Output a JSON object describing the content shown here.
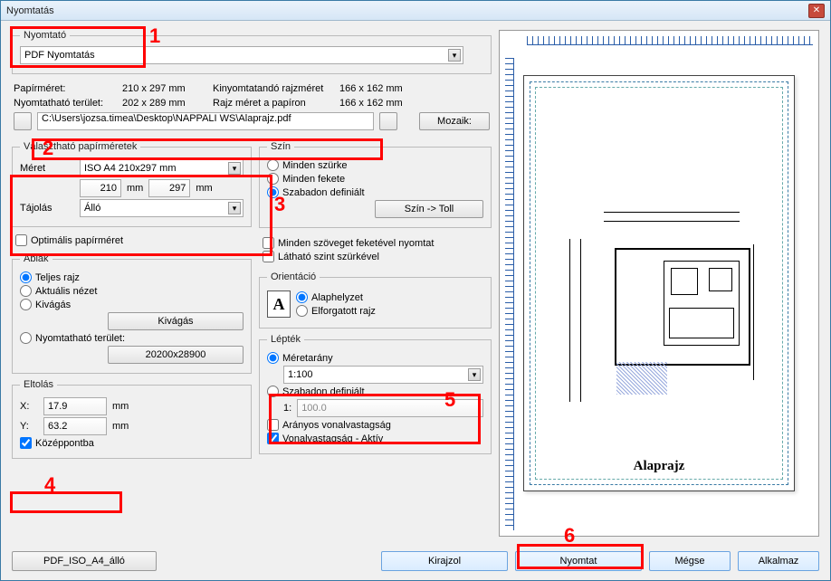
{
  "window": {
    "title": "Nyomtatás"
  },
  "printer": {
    "legend": "Nyomtató",
    "selected": "PDF Nyomtatás"
  },
  "info": {
    "paper_label": "Papírméret:",
    "paper_val": "210 x 297 mm",
    "printarea_label": "Nyomtatható terület:",
    "printarea_val": "202 x 289 mm",
    "drawsize_label": "Kinyomtatandó rajzméret",
    "drawsize_val": "166 x 162 mm",
    "drawpaper_label": "Rajz méret a papíron",
    "drawpaper_val": "166 x 162 mm"
  },
  "filepath": "C:\\Users\\jozsa.timea\\Desktop\\NAPPALI WS\\Alaprajz.pdf",
  "mozaik_btn": "Mozaik:",
  "sizes": {
    "legend": "Választható papírméretek",
    "meret_label": "Méret",
    "meret_val": "ISO A4 210x297 mm",
    "w": "210",
    "h": "297",
    "mm": "mm",
    "tajolas_label": "Tájolás",
    "tajolas_val": "Álló",
    "optimal": "Optimális papírméret"
  },
  "color": {
    "legend": "Szín",
    "all_gray": "Minden szürke",
    "all_black": "Minden fekete",
    "free": "Szabadon definiált",
    "btn": "Szín -> Toll"
  },
  "textopts": {
    "black_text": "Minden szöveget feketével nyomtat",
    "gray_level": "Látható szint szürkével"
  },
  "window_group": {
    "legend": "Ablak",
    "full": "Teljes rajz",
    "current": "Aktuális nézet",
    "cut": "Kivágás",
    "cut_btn": "Kivágás",
    "printarea": "Nyomtatható terület:",
    "dim_btn": "20200x28900"
  },
  "orient": {
    "legend": "Orientáció",
    "default": "Alaphelyzet",
    "rotated": "Elforgatott rajz"
  },
  "scale": {
    "legend": "Lépték",
    "ratio": "Méretarány",
    "ratio_val": "1:100",
    "free": "Szabadon definiált",
    "one": "1:",
    "free_val": "100.0",
    "prop_weight": "Arányos vonalvastagság",
    "weight_active": "Vonalvastagság - Aktív"
  },
  "offset": {
    "legend": "Eltolás",
    "x": "X:",
    "x_val": "17.9",
    "y": "Y:",
    "y_val": "63.2",
    "mm": "mm",
    "center": "Középpontba"
  },
  "footer": {
    "preset": "PDF_ISO_A4_álló",
    "draw": "Kirajzol",
    "print": "Nyomtat",
    "cancel": "Mégse",
    "apply": "Alkalmaz"
  },
  "preview": {
    "caption": "Alaprajz"
  },
  "annotations": {
    "n1": "1",
    "n2": "2",
    "n3": "3",
    "n4": "4",
    "n5": "5",
    "n6": "6"
  }
}
